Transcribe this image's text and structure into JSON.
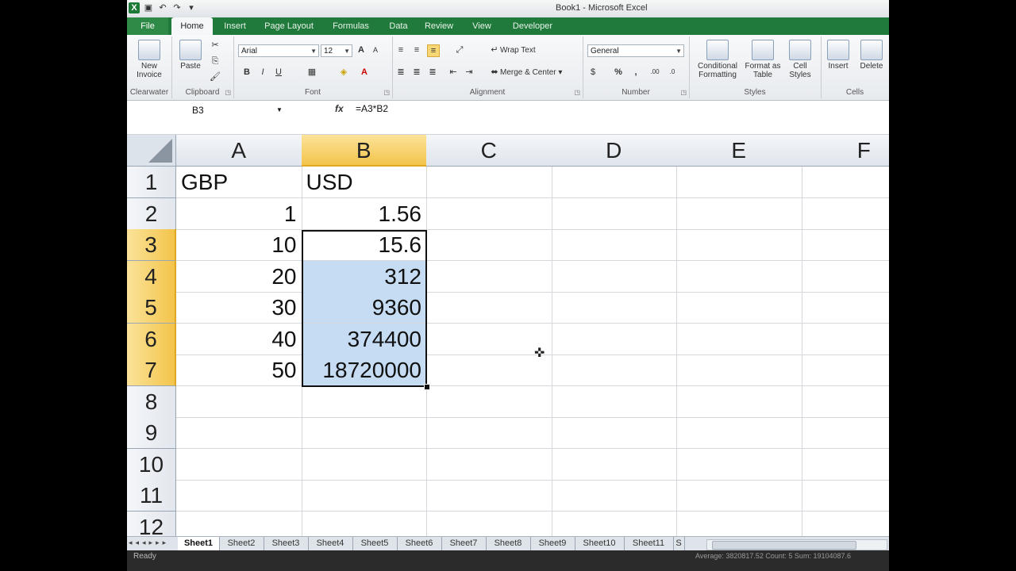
{
  "window": {
    "title": "Book1 - Microsoft Excel"
  },
  "tabs": [
    "File",
    "Home",
    "Insert",
    "Page Layout",
    "Formulas",
    "Data",
    "Review",
    "View",
    "Developer"
  ],
  "ribbon": {
    "clearwater": {
      "button": "New Invoice",
      "group": "Clearwater"
    },
    "clipboard": {
      "paste": "Paste",
      "group": "Clipboard"
    },
    "font": {
      "name": "Arial",
      "size": "12",
      "group": "Font",
      "bold": "B",
      "italic": "I",
      "underline": "U"
    },
    "alignment": {
      "wrap": "Wrap Text",
      "merge": "Merge & Center",
      "group": "Alignment"
    },
    "number": {
      "format": "General",
      "group": "Number",
      "percent": "%",
      "comma": ","
    },
    "styles": {
      "conditional": "Conditional Formatting",
      "format_table": "Format as Table",
      "cell_styles": "Cell Styles",
      "group": "Styles"
    },
    "cells": {
      "insert": "Insert",
      "delete": "Delete",
      "group": "Cells"
    }
  },
  "formula_bar": {
    "name_box": "B3",
    "fx": "fx",
    "formula": "=A3*B2"
  },
  "columns": [
    "A",
    "B",
    "C",
    "D",
    "E",
    "F"
  ],
  "rows": [
    "1",
    "2",
    "3",
    "4",
    "5",
    "6",
    "7",
    "8",
    "9",
    "10",
    "11",
    "12"
  ],
  "cells": {
    "A1": "GBP",
    "B1": "USD",
    "A2": "1",
    "B2": "1.56",
    "A3": "10",
    "B3": "15.6",
    "A4": "20",
    "B4": "312",
    "A5": "30",
    "B5": "9360",
    "A6": "40",
    "B6": "374400",
    "A7": "50",
    "B7": "18720000"
  },
  "sheets": [
    "Sheet1",
    "Sheet2",
    "Sheet3",
    "Sheet4",
    "Sheet5",
    "Sheet6",
    "Sheet7",
    "Sheet8",
    "Sheet9",
    "Sheet10",
    "Sheet11",
    "S"
  ],
  "active_sheet": "Sheet1",
  "status": {
    "ready": "Ready",
    "summary": "Average: 3820817.52    Count: 5    Sum: 19104087.6"
  }
}
